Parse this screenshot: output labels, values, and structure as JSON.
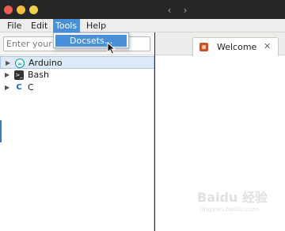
{
  "window": {
    "controls": [
      "close",
      "minimize",
      "maximize"
    ],
    "control_colors": {
      "close": "#ee5c4f",
      "minimize": "#f5bf3c",
      "maximize": "#f0d24a"
    }
  },
  "menubar": {
    "items": [
      {
        "label": "File",
        "active": false
      },
      {
        "label": "Edit",
        "active": false
      },
      {
        "label": "Tools",
        "active": true
      },
      {
        "label": "Help",
        "active": false
      }
    ]
  },
  "tools_menu": {
    "items": [
      {
        "label": "Docsets...",
        "highlighted": true
      }
    ]
  },
  "search": {
    "placeholder": "Enter your q",
    "value": ""
  },
  "docsets": [
    {
      "label": "Arduino",
      "icon": "arduino-icon",
      "expanded": false,
      "selected": true
    },
    {
      "label": "Bash",
      "icon": "bash-icon",
      "expanded": false,
      "selected": false
    },
    {
      "label": "C",
      "icon": "c-icon",
      "expanded": false,
      "selected": false
    }
  ],
  "tabs": [
    {
      "label": "Welcome",
      "icon": "zeal-icon",
      "active": true
    }
  ],
  "nav": {
    "back_icon": "chevron-left-icon",
    "forward_icon": "chevron-right-icon"
  },
  "watermark": {
    "text": "Baidu 经验",
    "sub": "jingyan.baidu.com"
  },
  "colors": {
    "accent": "#4a90d9",
    "selection": "#dde9f6"
  }
}
